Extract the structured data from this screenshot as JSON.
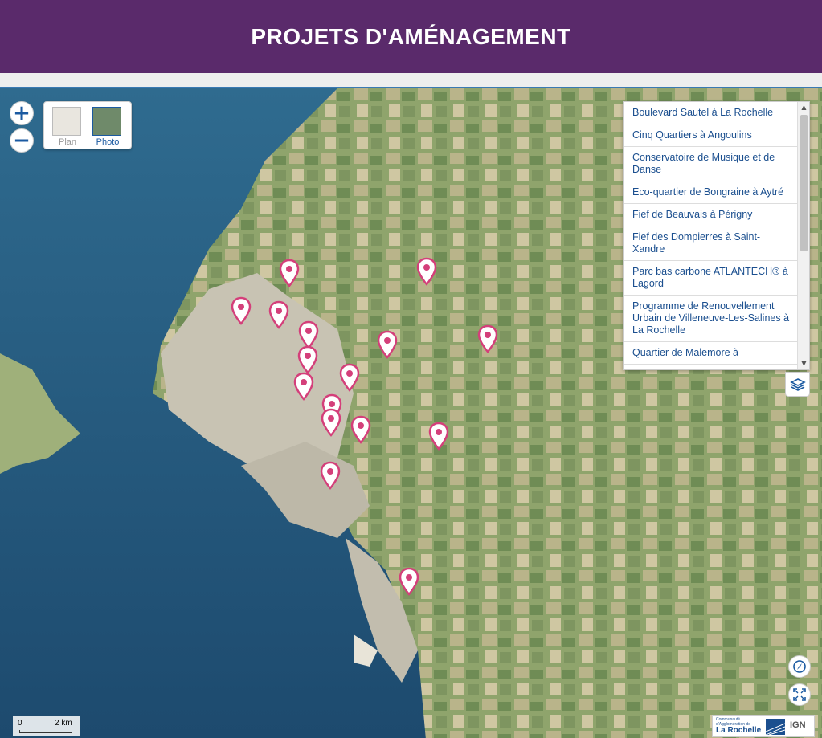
{
  "header": {
    "title": "PROJETS D'AMÉNAGEMENT"
  },
  "map": {
    "zoom_in_label": "+",
    "zoom_out_label": "−",
    "basemap": {
      "plan_label": "Plan",
      "photo_label": "Photo",
      "selected": "Photo"
    },
    "projects": [
      "Boulevard Sautel à La Rochelle",
      "Cinq Quartiers à Angoulins",
      "Conservatoire de Musique et de Danse",
      "Eco-quartier de Bongraine à Aytré",
      "Fief de Beauvais à Périgny",
      "Fief des Dompierres à Saint-Xandre",
      "Parc bas carbone ATLANTECH® à Lagord",
      "Programme de Renouvellement Urbain de Villeneuve-Les-Salines à La Rochelle",
      "Quartier de Malemore à"
    ],
    "scale": {
      "start": "0",
      "end": "2 km"
    },
    "attribution": {
      "agglo_line1": "Communauté",
      "agglo_line2": "d'Agglomération de",
      "agglo_name": "La Rochelle",
      "ign": "IGN"
    },
    "colors": {
      "header": "#5a2a6b",
      "marker": "#d43f7a",
      "link": "#1b4f8f",
      "control": "#1b5aa1"
    },
    "icons": {
      "layers": "layers-icon",
      "rotate": "compass-icon",
      "fullscreen": "fullscreen-icon",
      "marker": "map-pin-icon"
    }
  }
}
